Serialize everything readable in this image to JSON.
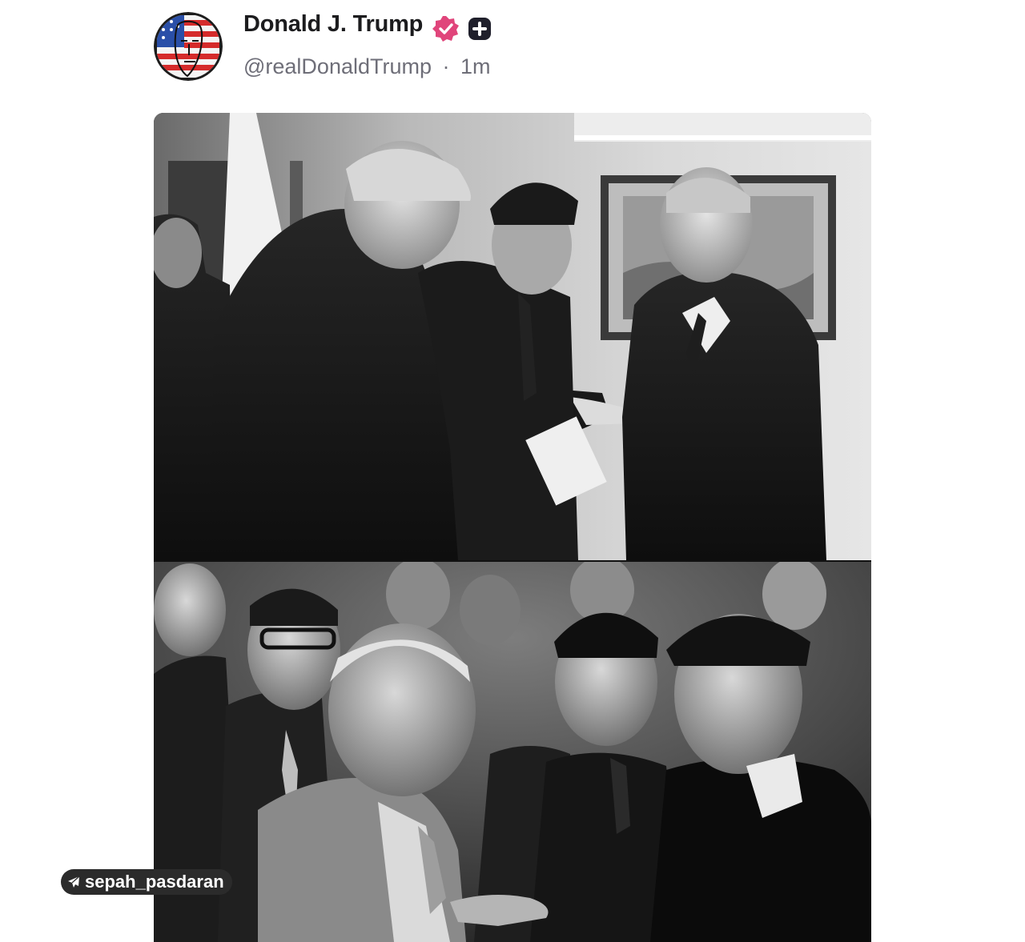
{
  "post": {
    "author": {
      "display_name": "Donald J. Trump",
      "handle": "@realDonaldTrump",
      "separator": "·",
      "time_ago": "1m",
      "avatar_icon": "flag-face-avatar",
      "verified_icon": "verified-badge-icon",
      "verified_color": "#e0457b",
      "plus_icon": "plus-badge-icon"
    },
    "media": {
      "top_photo": "black-and-white photo of men in suits, one pointing a finger at another",
      "bottom_photo": "black-and-white historical photo of men in suits, one pointing a finger"
    }
  },
  "watermark": {
    "icon": "telegram-icon",
    "text": "sepah_pasdaran"
  },
  "colors": {
    "name": "#1c1c1e",
    "handle": "#6e6e78",
    "verified": "#e0457b",
    "badge_dark": "#1f1f2b"
  }
}
